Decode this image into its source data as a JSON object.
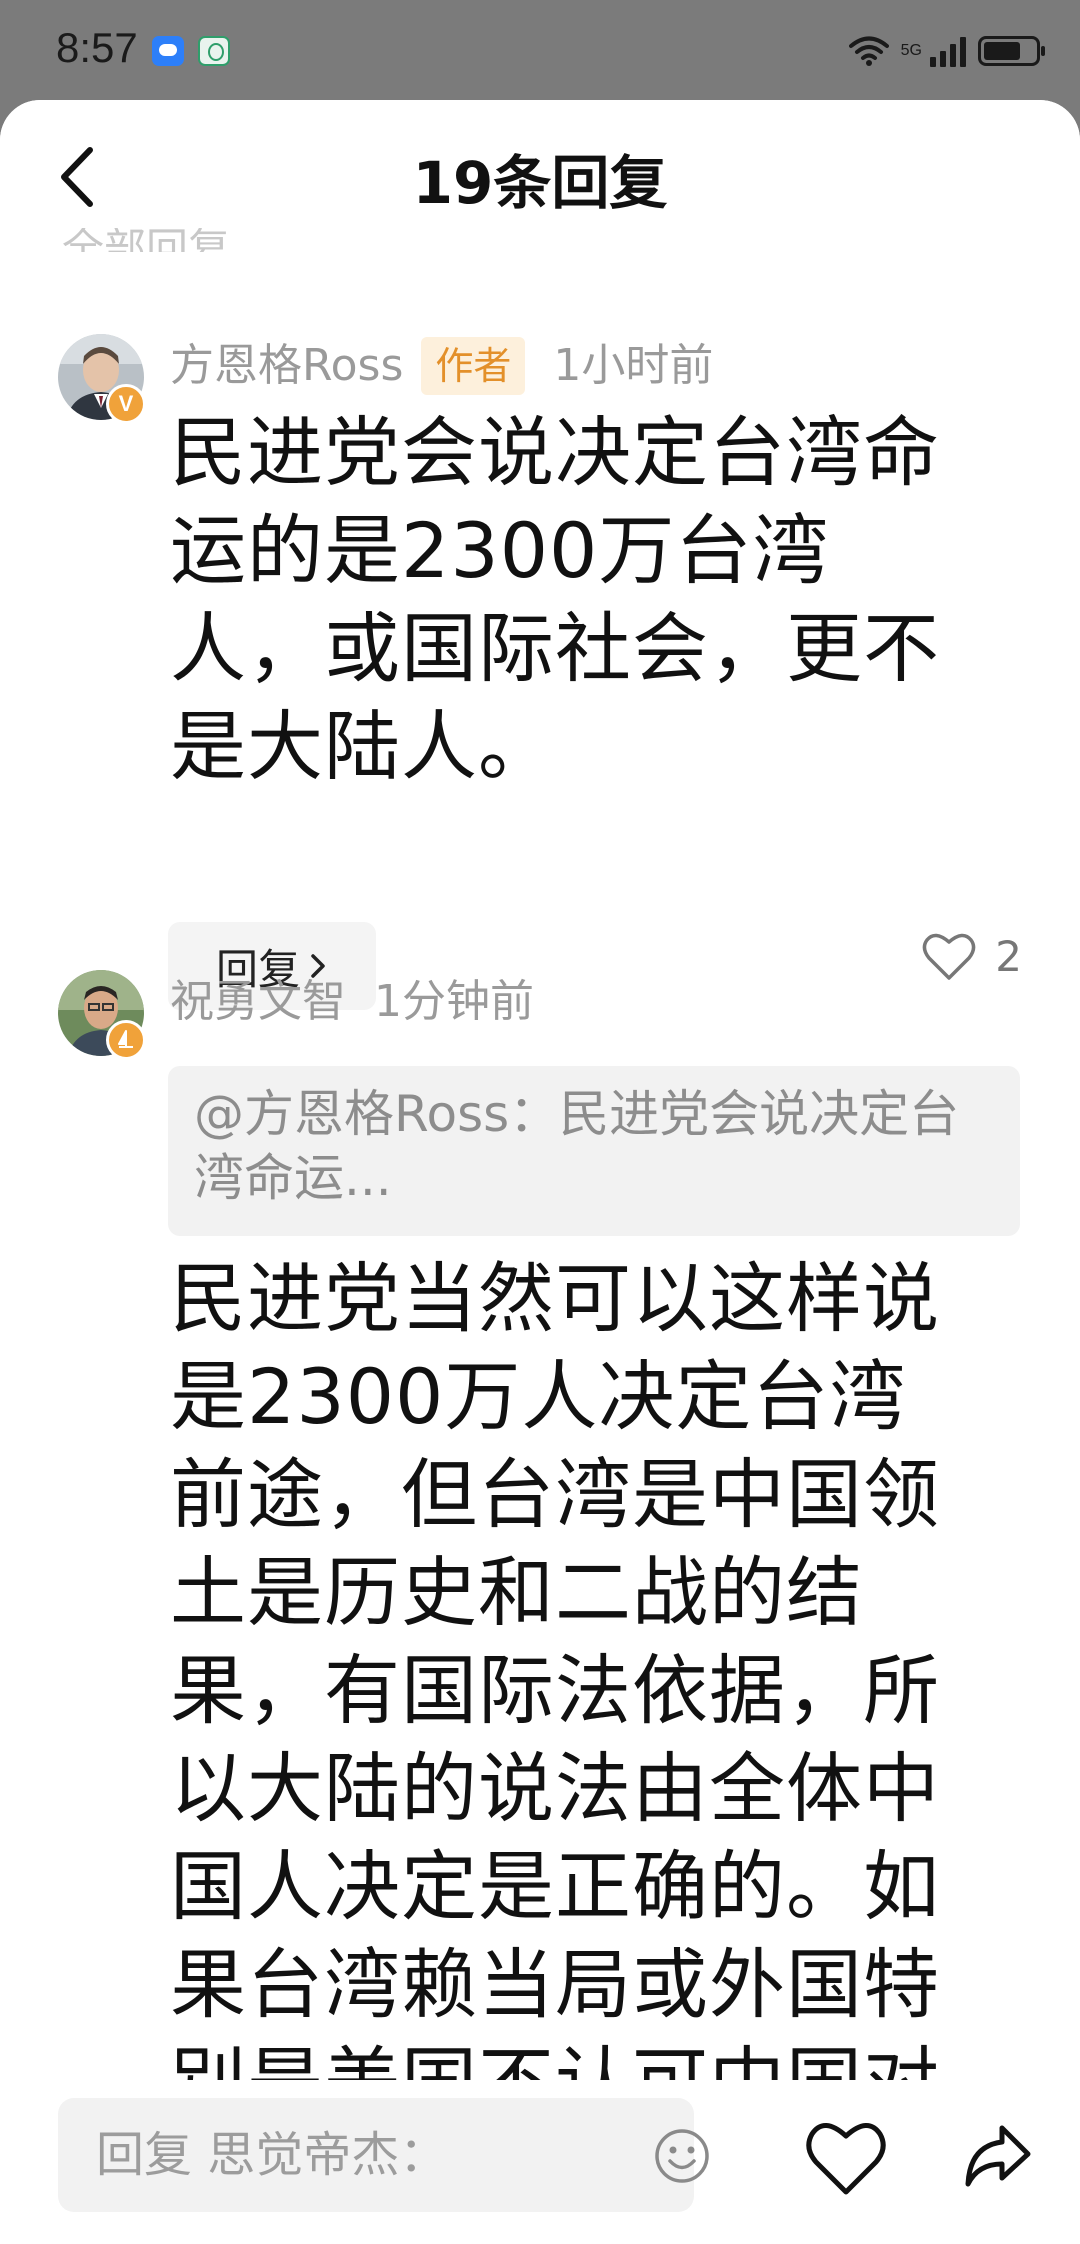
{
  "status_bar": {
    "time": "8:57",
    "network": "5G",
    "icons": [
      "message-app-icon",
      "bank-app-icon",
      "wifi-icon",
      "signal-icon",
      "battery-icon"
    ]
  },
  "header": {
    "title": "19条回复",
    "faded_label": "全部回复"
  },
  "comments": [
    {
      "author": "方恩格Ross",
      "author_tag": "作者",
      "time": "1小时前",
      "badge": "V",
      "text": "民进党会说决定台湾命运的是2300万台湾人，或国际社会，更不是大陆人。",
      "reply_label": "回复",
      "like_count": "2"
    },
    {
      "author": "祝勇文智",
      "time": "1分钟前",
      "quote": "@方恩格Ross：民进党会说决定台湾命运...",
      "text": "民进党当然可以这样说是2300万人决定台湾前途，但台湾是中国领土是历史和二战的结果，有国际法依据，所以大陆的说法由全体中国人决定是正确的。如果台湾赖当局或外国特别是美国不认可中国对台湾"
    }
  ],
  "bottom_bar": {
    "reply_placeholder": "回复 思觉帝杰："
  },
  "colors": {
    "author_tag_bg": "#fdf0dc",
    "author_tag_text": "#e3902a",
    "badge": "#f0a23a"
  }
}
